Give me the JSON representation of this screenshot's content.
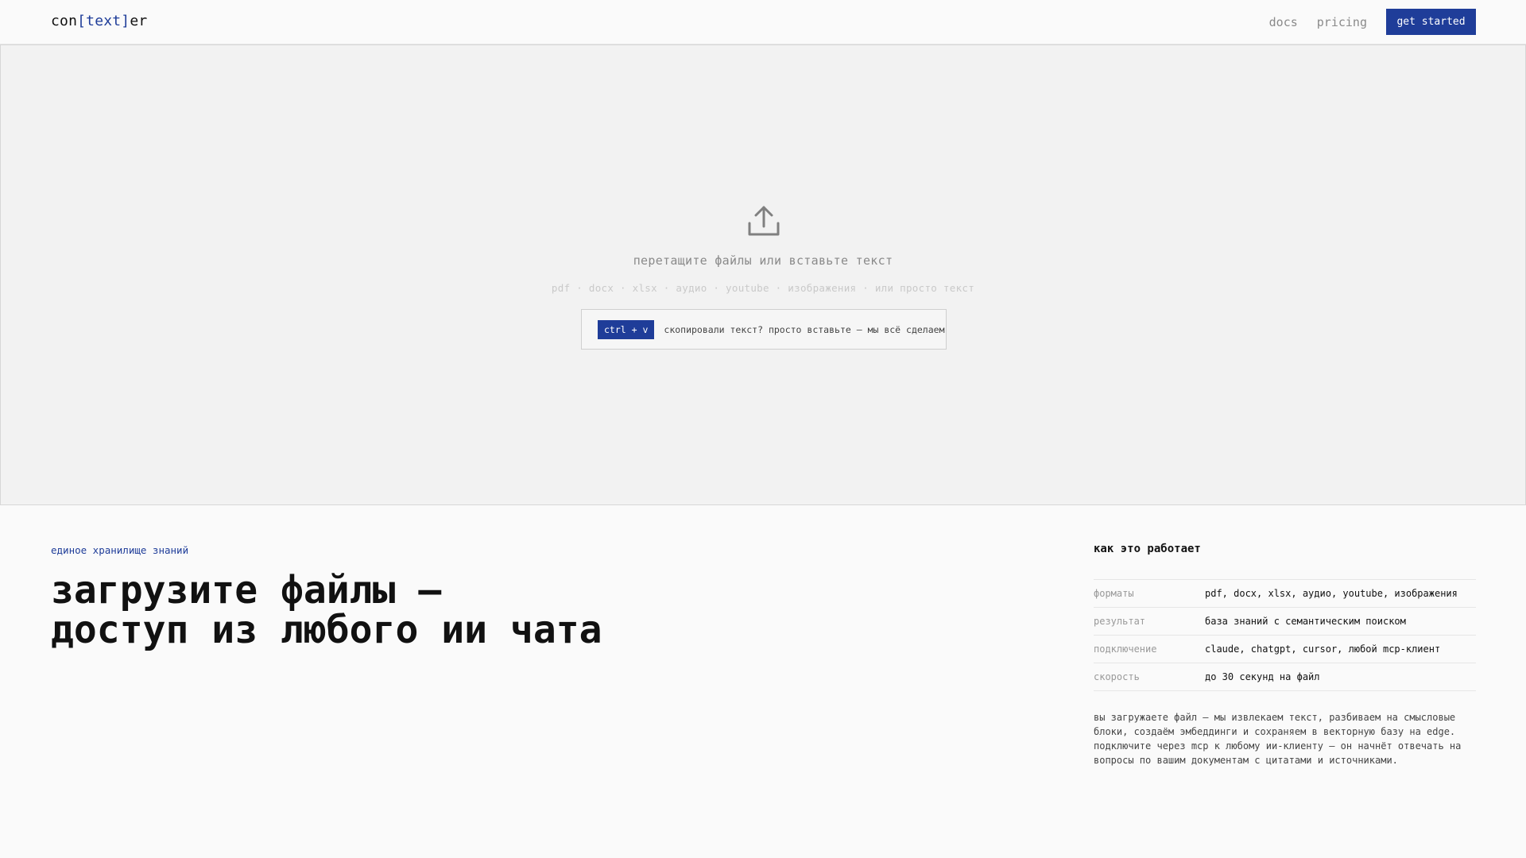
{
  "header": {
    "logo_prefix": "con",
    "logo_accent": "[text]",
    "logo_suffix": "er",
    "nav": [
      "docs",
      "pricing"
    ],
    "cta_label": "get started"
  },
  "dropzone": {
    "title": "перетащите файлы или вставьте текст",
    "formats": "pdf · docx · xlsx · аудио · youtube · изображения · или просто текст",
    "shortcut": "ctrl + v",
    "paste_hint": "скопировали текст? просто вставьте — мы всё сделаем"
  },
  "hero": {
    "eyebrow": "единое хранилище знаний",
    "headline_line1": "загрузите файлы —",
    "headline_line2": "доступ из любого ии чата"
  },
  "how": {
    "title": "как это работает",
    "rows": [
      {
        "label": "форматы",
        "value": "pdf, docx, xlsx, аудио, youtube, изображения"
      },
      {
        "label": "результат",
        "value": "база знаний с семантическим поиском"
      },
      {
        "label": "подключение",
        "value": "claude, chatgpt, cursor, любой mcp-клиент"
      },
      {
        "label": "скорость",
        "value": "до 30 секунд на файл"
      }
    ],
    "description_lines": [
      "вы загружаете файл — мы извлекаем текст, разбиваем на смысловые",
      "блоки, создаём эмбеддинги и сохраняем в векторную базу на edge.",
      "подключите через mcp к любому ии-клиенту — он начнёт отвечать на",
      "вопросы по вашим документам с цитатами и источниками."
    ]
  },
  "colors": {
    "accent": "#1f3d99",
    "background": "#fafafa",
    "dropzone_bg": "#f2f2f2"
  }
}
